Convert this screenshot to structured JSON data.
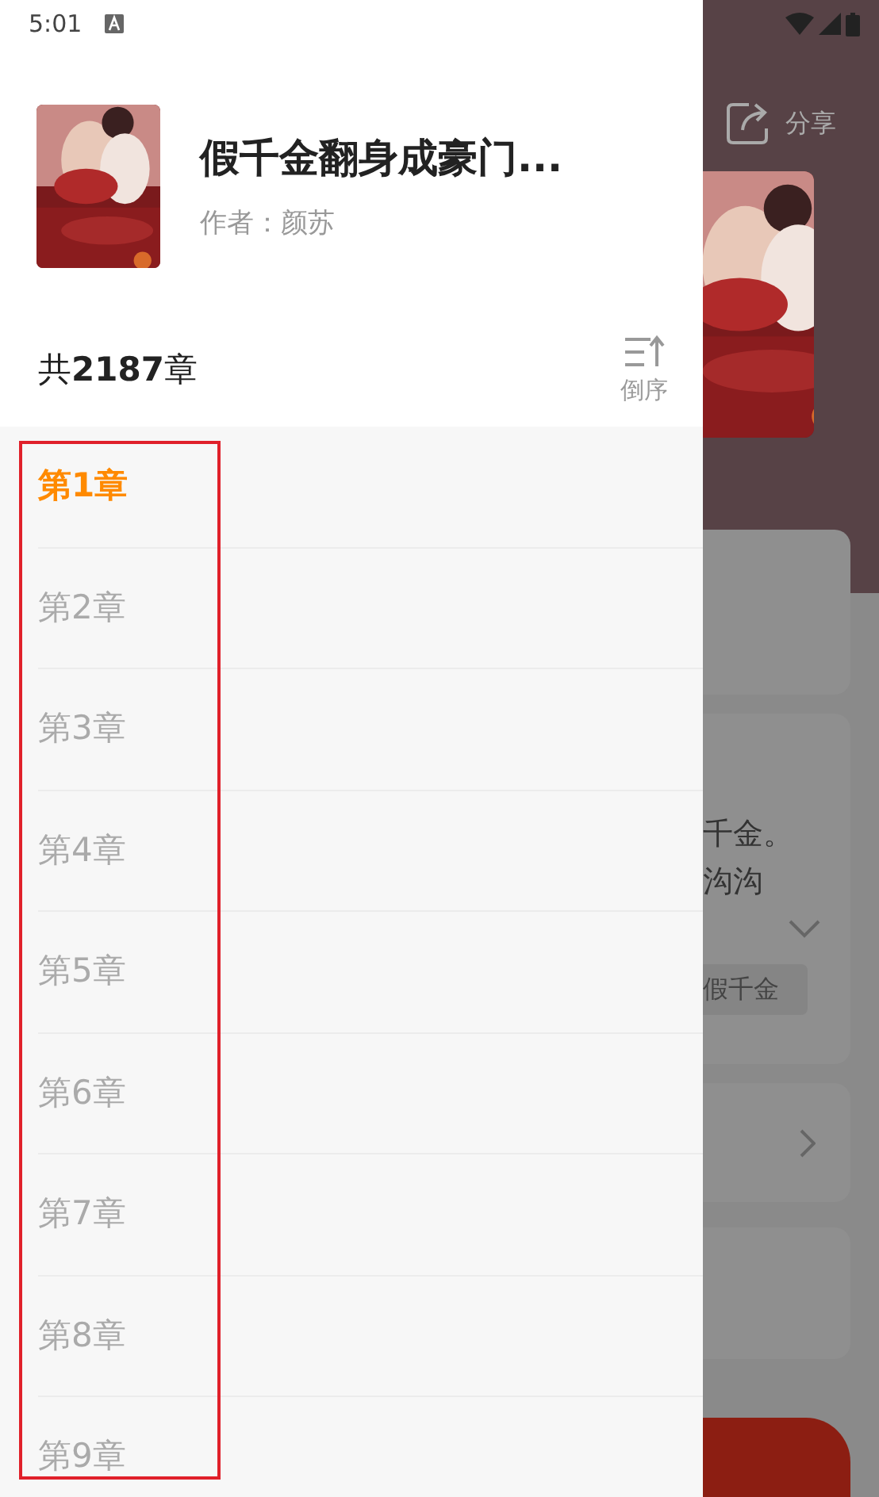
{
  "status_bar": {
    "time": "5:01"
  },
  "drawer": {
    "book": {
      "title": "假千金翻身成豪门...",
      "author": "作者：颜苏"
    },
    "chapter_count": "共**2187**章",
    "sort_button": {
      "label": "倒序"
    },
    "chapters": [
      {
        "title": "第1章",
        "selected": true
      },
      {
        "title": "第2章",
        "selected": false
      },
      {
        "title": "第3章",
        "selected": false
      },
      {
        "title": "第4章",
        "selected": false
      },
      {
        "title": "第5章",
        "selected": false
      },
      {
        "title": "第6章",
        "selected": false
      },
      {
        "title": "第7章",
        "selected": false
      },
      {
        "title": "第8章",
        "selected": false
      },
      {
        "title": "第9章",
        "selected": false
      }
    ]
  },
  "background_page": {
    "share_label": "分享",
    "summary_lines": [
      "千金。",
      "沟沟"
    ],
    "tag": "假千金"
  }
}
